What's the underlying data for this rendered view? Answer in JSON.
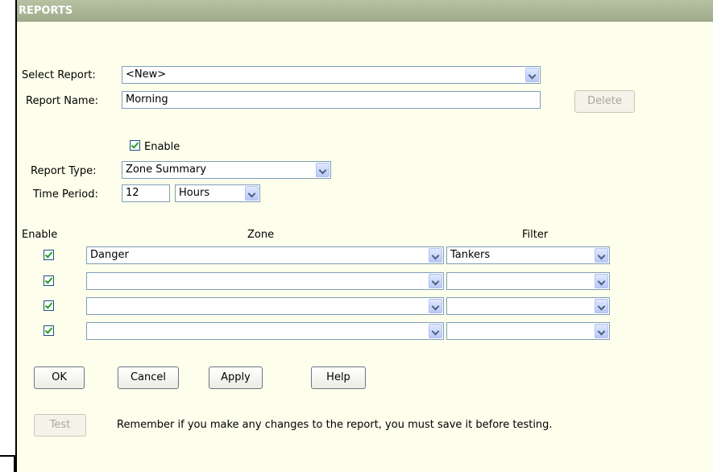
{
  "panel": {
    "title": "REPORTS"
  },
  "select_report": {
    "label": "Select Report:",
    "value": "<New>"
  },
  "report_name": {
    "label": "Report Name:",
    "value": "Morning"
  },
  "delete_label": "Delete",
  "enable": {
    "label": "Enable",
    "checked": true
  },
  "report_type": {
    "label": "Report Type:",
    "value": "Zone Summary"
  },
  "time_period": {
    "label": "Time Period:",
    "value": "12",
    "unit": "Hours"
  },
  "table": {
    "headers": {
      "enable": "Enable",
      "zone": "Zone",
      "filter": "Filter"
    },
    "rows": [
      {
        "enabled": true,
        "zone": "Danger",
        "filter": "Tankers"
      },
      {
        "enabled": true,
        "zone": "",
        "filter": ""
      },
      {
        "enabled": true,
        "zone": "",
        "filter": ""
      },
      {
        "enabled": true,
        "zone": "",
        "filter": ""
      }
    ]
  },
  "buttons": {
    "ok": "OK",
    "cancel": "Cancel",
    "apply": "Apply",
    "help": "Help",
    "test": "Test"
  },
  "note": "Remember if you make any changes to the report, you must save it before testing."
}
